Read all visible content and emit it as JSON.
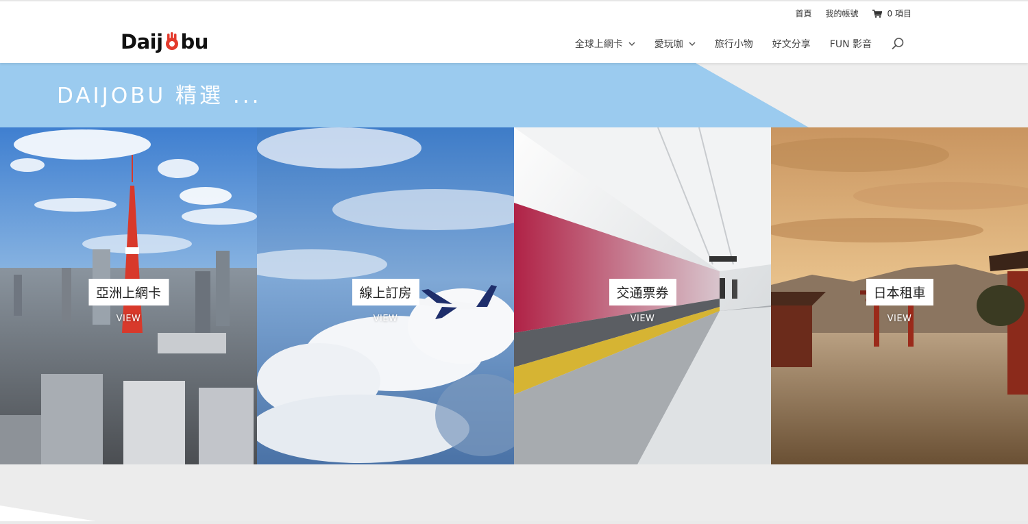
{
  "topbar": {
    "home": "首頁",
    "account": "我的帳號",
    "cart_count": "0 項目"
  },
  "header": {
    "logo_prefix": "Daij",
    "logo_suffix": "bu",
    "nav": [
      {
        "label": "全球上網卡",
        "has_dropdown": true
      },
      {
        "label": "愛玩咖",
        "has_dropdown": true
      },
      {
        "label": "旅行小物",
        "has_dropdown": false
      },
      {
        "label": "好文分享",
        "has_dropdown": false
      },
      {
        "label": "FUN 影音",
        "has_dropdown": false
      }
    ]
  },
  "banner": {
    "title": "DAIJOBU 精選 ...",
    "accent_color": "#9bcbef"
  },
  "tiles": [
    {
      "label": "亞洲上網卡",
      "view": "VIEW"
    },
    {
      "label": "線上訂房",
      "view": "VIEW"
    },
    {
      "label": "交通票券",
      "view": "VIEW"
    },
    {
      "label": "日本租車",
      "view": "VIEW"
    }
  ],
  "icons": {
    "cart": "cart-icon",
    "search": "search-icon",
    "dropdown": "chevron-down-icon"
  }
}
